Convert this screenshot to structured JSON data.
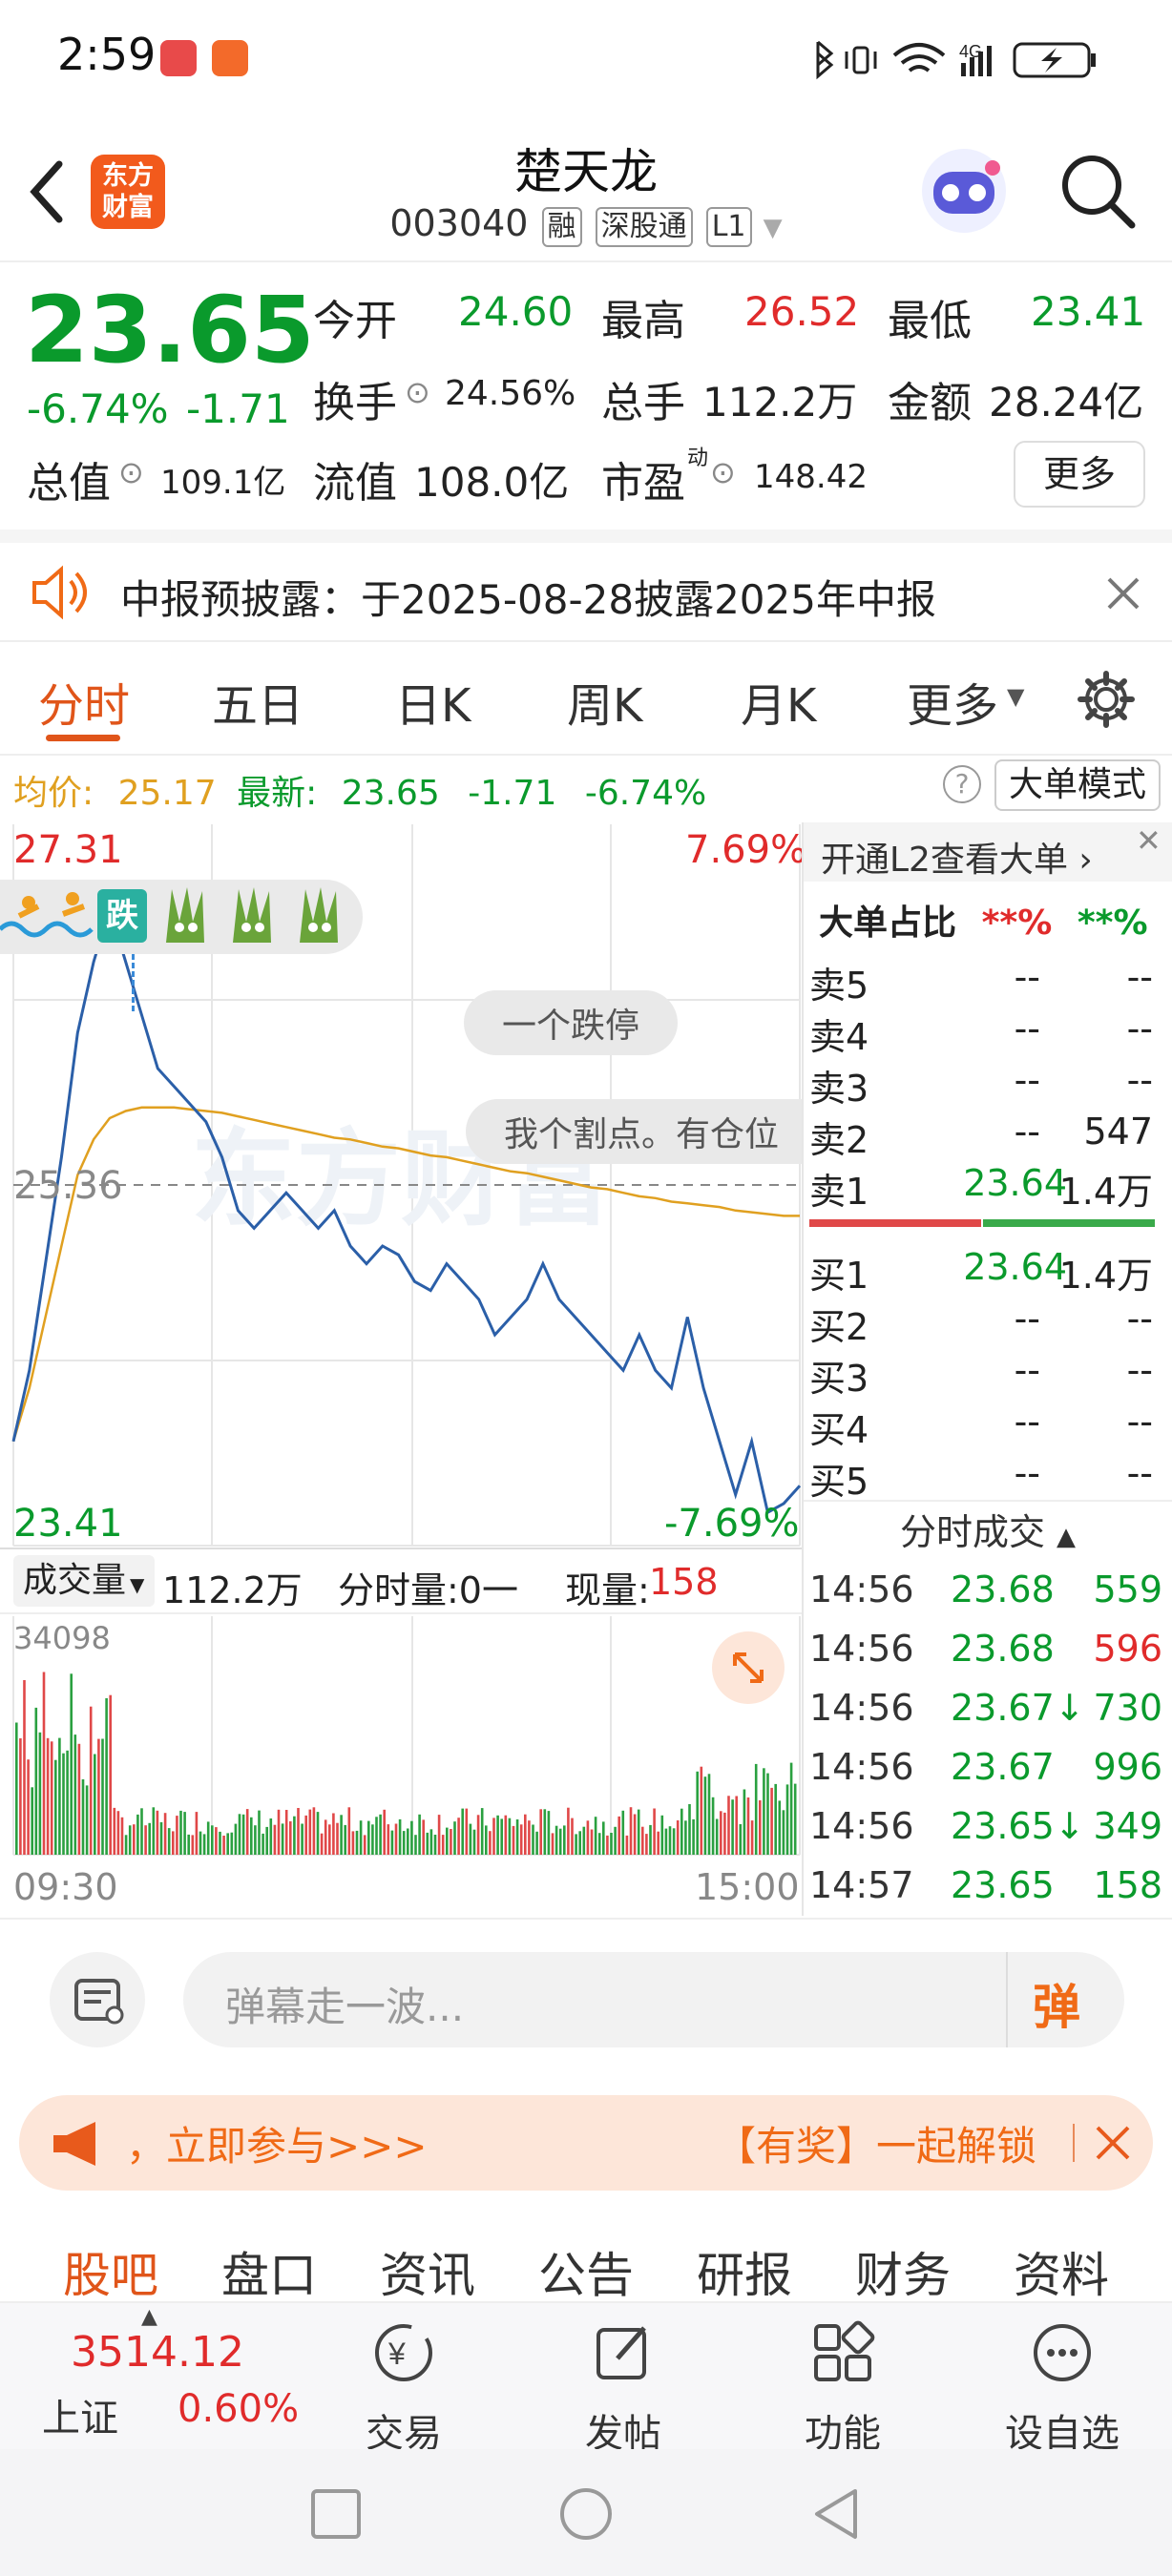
{
  "status_bar": {
    "time": "2:59",
    "network": "4G"
  },
  "header": {
    "logo_text": "东方\n财富",
    "stock_name": "楚天龙",
    "stock_code": "003040",
    "tags": [
      "融",
      "深股通",
      "L1"
    ]
  },
  "quote": {
    "price": "23.65",
    "change_pct": "-6.74%",
    "change": "-1.71",
    "rows": [
      [
        {
          "label": "今开",
          "value": "24.60",
          "color": "green"
        },
        {
          "label": "最高",
          "value": "26.52",
          "color": "red"
        },
        {
          "label": "最低",
          "value": "23.41",
          "color": "green"
        }
      ],
      [
        {
          "label": "换手",
          "value": "24.56%",
          "color": "black",
          "info": true
        },
        {
          "label": "总手",
          "value": "112.2万",
          "color": "black"
        },
        {
          "label": "金额",
          "value": "28.24亿",
          "color": "black"
        }
      ],
      [
        {
          "label": "总值",
          "value": "109.1亿",
          "color": "black",
          "info": true
        },
        {
          "label": "流值",
          "value": "108.0亿",
          "color": "black"
        },
        {
          "label": "市盈",
          "sup": "动",
          "value": "148.42",
          "color": "black",
          "info": true
        }
      ]
    ],
    "more_button": "更多"
  },
  "notice": {
    "text": "中报预披露：于2025-08-28披露2025年中报"
  },
  "chart_tabs": [
    "分时",
    "五日",
    "日K",
    "周K",
    "月K",
    "更多"
  ],
  "info_line": {
    "avg_label": "均价:",
    "avg_value": "25.17",
    "latest_label": "最新:",
    "latest_value": "23.65",
    "change": "-1.71",
    "change_pct": "-6.74%",
    "mode_button": "大单模式"
  },
  "chart_data": {
    "type": "line",
    "title": "",
    "series": [
      {
        "name": "最新",
        "color": "#2b5fa8",
        "values": [
          23.9,
          24.3,
          24.9,
          25.5,
          26.2,
          26.6,
          26.9,
          26.6,
          26.3,
          26.0,
          25.9,
          25.8,
          25.7,
          25.5,
          25.2,
          25.1,
          25.2,
          25.3,
          25.2,
          25.1,
          25.2,
          25.0,
          24.9,
          25.0,
          24.95,
          24.8,
          24.75,
          24.9,
          24.8,
          24.7,
          24.5,
          24.6,
          24.7,
          24.9,
          24.7,
          24.6,
          24.5,
          24.4,
          24.3,
          24.5,
          24.3,
          24.2,
          24.6,
          24.2,
          23.9,
          23.6,
          23.9,
          23.5,
          23.55,
          23.65
        ]
      },
      {
        "name": "均价",
        "color": "#e0a020",
        "values": [
          23.9,
          24.2,
          24.6,
          25.0,
          25.4,
          25.6,
          25.72,
          25.76,
          25.78,
          25.78,
          25.78,
          25.77,
          25.76,
          25.75,
          25.73,
          25.71,
          25.69,
          25.67,
          25.65,
          25.63,
          25.61,
          25.6,
          25.58,
          25.56,
          25.55,
          25.53,
          25.51,
          25.5,
          25.48,
          25.46,
          25.44,
          25.42,
          25.41,
          25.39,
          25.37,
          25.35,
          25.33,
          25.32,
          25.3,
          25.28,
          25.27,
          25.25,
          25.24,
          25.23,
          25.22,
          25.2,
          25.19,
          25.18,
          25.17,
          25.17
        ]
      }
    ],
    "ylim": [
      23.41,
      27.31
    ],
    "ref_line": "25.36",
    "top_left": "27.31",
    "top_right": "7.69%",
    "bottom_left": "23.41",
    "bottom_right": "-7.69%",
    "x_start": "09:30",
    "x_end": "15:00",
    "grid": true,
    "volume": {
      "label": "成交量",
      "total": "112.2万",
      "per_min_label": "分时量:0一",
      "now_label": "现量:",
      "now_value": "158",
      "max_label": "34098"
    }
  },
  "overlay_chips": [
    "一个跌停",
    "我个割点。有仓位"
  ],
  "watermark": "东方财富",
  "sticker_label": "跌",
  "orderbook": {
    "header": "开通L2查看大单 ›",
    "ratio_label": "大单占比",
    "ratio_red": "**%",
    "ratio_green": "**%",
    "sells": [
      {
        "label": "卖5",
        "price": "--",
        "vol": "--"
      },
      {
        "label": "卖4",
        "price": "--",
        "vol": "--"
      },
      {
        "label": "卖3",
        "price": "--",
        "vol": "--"
      },
      {
        "label": "卖2",
        "price": "--",
        "vol": "547"
      },
      {
        "label": "卖1",
        "price": "23.64",
        "vol": "1.4万"
      }
    ],
    "buys": [
      {
        "label": "买1",
        "price": "23.64",
        "vol": "1.4万"
      },
      {
        "label": "买2",
        "price": "--",
        "vol": "--"
      },
      {
        "label": "买3",
        "price": "--",
        "vol": "--"
      },
      {
        "label": "买4",
        "price": "--",
        "vol": "--"
      },
      {
        "label": "买5",
        "price": "--",
        "vol": "--"
      }
    ],
    "ticks_header": "分时成交",
    "ticks": [
      {
        "time": "14:56",
        "price": "23.68",
        "arrow": "",
        "vol": "559",
        "vol_color": "green"
      },
      {
        "time": "14:56",
        "price": "23.68",
        "arrow": "",
        "vol": "596",
        "vol_color": "red"
      },
      {
        "time": "14:56",
        "price": "23.67",
        "arrow": "↓",
        "vol": "730",
        "vol_color": "green"
      },
      {
        "time": "14:56",
        "price": "23.67",
        "arrow": "",
        "vol": "996",
        "vol_color": "green"
      },
      {
        "time": "14:56",
        "price": "23.65",
        "arrow": "↓",
        "vol": "349",
        "vol_color": "green"
      },
      {
        "time": "14:57",
        "price": "23.65",
        "arrow": "",
        "vol": "158",
        "vol_color": "green"
      }
    ]
  },
  "barrage": {
    "placeholder": "弹幕走一波...",
    "button": "弹"
  },
  "promo": {
    "text": "，立即参与>>>",
    "highlight": "【有奖】一起解锁"
  },
  "bottom_tabs": [
    "股吧",
    "盘口",
    "资讯",
    "公告",
    "研报",
    "财务",
    "资料"
  ],
  "bottom_bar": {
    "index_value": "3514.12",
    "index_name": "上证",
    "index_pct": "0.60%",
    "items": [
      {
        "label": "交易",
        "icon": "trade-icon"
      },
      {
        "label": "发帖",
        "icon": "post-icon"
      },
      {
        "label": "功能",
        "icon": "function-icon"
      },
      {
        "label": "设自选",
        "icon": "add-watchlist-icon"
      }
    ]
  }
}
